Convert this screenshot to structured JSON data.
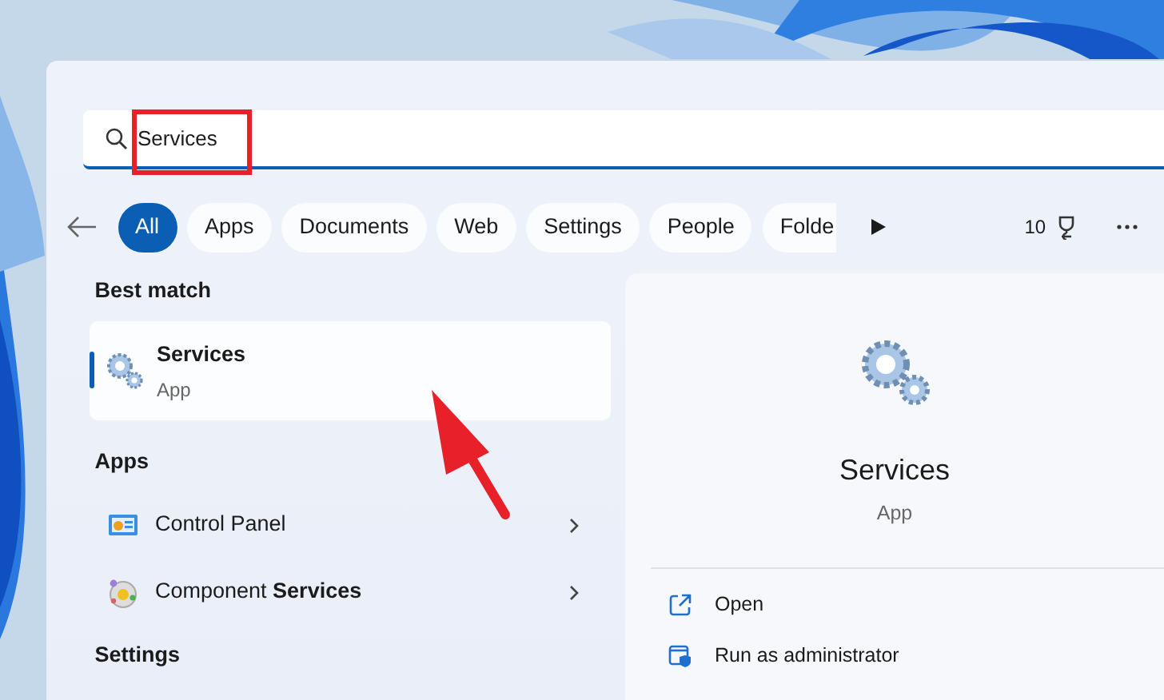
{
  "search": {
    "value": "Services"
  },
  "filters": [
    {
      "label": "All",
      "selected": true
    },
    {
      "label": "Apps",
      "selected": false
    },
    {
      "label": "Documents",
      "selected": false
    },
    {
      "label": "Web",
      "selected": false
    },
    {
      "label": "Settings",
      "selected": false
    },
    {
      "label": "People",
      "selected": false
    },
    {
      "label": "Folde",
      "selected": false
    }
  ],
  "points": "10",
  "best_match": {
    "heading": "Best match",
    "title": "Services",
    "subtitle": "App",
    "selected": true
  },
  "apps": {
    "heading": "Apps",
    "items": [
      {
        "label": "Control Panel"
      },
      {
        "label": "Component **Services**"
      }
    ]
  },
  "settings_heading": "Settings",
  "details": {
    "title": "Services",
    "subtitle": "App",
    "actions": [
      {
        "label": "Open"
      },
      {
        "label": "Run as administrator"
      }
    ]
  },
  "annotations": {
    "highlight_box": true,
    "pointer_arrow": true
  }
}
